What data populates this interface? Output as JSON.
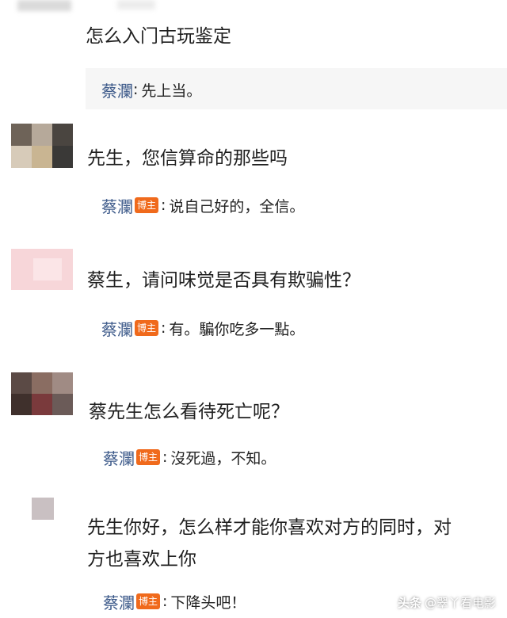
{
  "comments": [
    {
      "text": "怎么入门古玩鉴定",
      "reply": {
        "user": "蔡瀾",
        "badge": "",
        "text": "先上当。"
      }
    },
    {
      "text": "先生，您信算命的那些吗",
      "reply": {
        "user": "蔡瀾",
        "badge": "博主",
        "text": "说自己好的，全信。"
      }
    },
    {
      "text": "蔡生，请问味觉是否具有欺骗性？",
      "reply": {
        "user": "蔡瀾",
        "badge": "博主",
        "text": "有。騙你吃多一點。"
      }
    },
    {
      "text": "蔡先生怎么看待死亡呢？",
      "reply": {
        "user": "蔡瀾",
        "badge": "博主",
        "text": "沒死過，不知。"
      }
    },
    {
      "text_line1": "先生你好，怎么样才能你喜欢对方的同时，对",
      "text_line2": "方也喜欢上你",
      "reply": {
        "user": "蔡瀾",
        "badge": "博主",
        "text": "下降头吧！"
      }
    }
  ],
  "watermark": {
    "logo": "头条",
    "text": "@翠丫看电影"
  },
  "colors": {
    "username": "#3d5a8a",
    "badge": "#f06a1c",
    "reply_bg": "#f6f6f6"
  }
}
